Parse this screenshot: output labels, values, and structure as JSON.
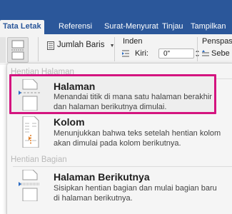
{
  "ribbon": {
    "tabs": [
      {
        "label": "Tata Letak",
        "active": true
      },
      {
        "label": "Referensi"
      },
      {
        "label": "Surat-Menyurat"
      },
      {
        "label": "Tinjau"
      },
      {
        "label": "Tampilkan"
      }
    ],
    "line_numbers_label": "Jumlah Baris",
    "indent_group_label": "Inden",
    "indent_left_label": "Kiri:",
    "indent_left_value": "0\"",
    "spacing_group_label": "Penspas",
    "spacing_before_label": "Sebe"
  },
  "menu": {
    "section_page_breaks": "Hentian Halaman",
    "section_section_breaks": "Hentian Bagian",
    "items": [
      {
        "title": "Halaman",
        "desc_line1": "Menandai titik di mana satu halaman berakhir",
        "desc_line2": "dan halaman berikutnya dimulai.",
        "icon": "page-break-icon",
        "highlighted": true
      },
      {
        "title": "Kolom",
        "desc_line1": "Menunjukkan bahwa teks setelah hentian kolom",
        "desc_line2": "akan dimulai pada kolom berikutnya.",
        "icon": "column-break-icon"
      },
      {
        "title": "Halaman Berikutnya",
        "desc_line1": "Sisipkan hentian bagian dan mulai bagian baru",
        "desc_line2": "di halaman berikutnya.",
        "icon": "section-next-page-icon"
      }
    ]
  },
  "colors": {
    "ribbon_blue": "#2b579a",
    "highlight": "#d4147f",
    "break_arrow": "#2b6cc4",
    "column_orange": "#e07a1f"
  }
}
